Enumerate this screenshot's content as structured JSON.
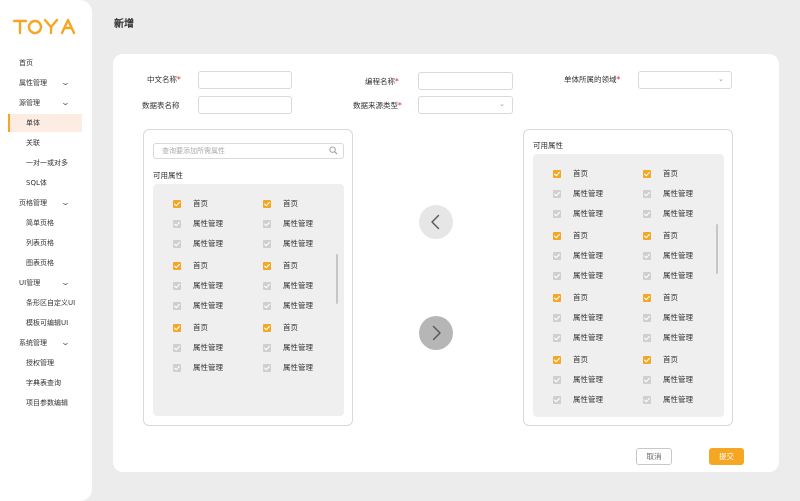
{
  "brand": {
    "logo_text": "TOYA",
    "logo_color": "#f5a623"
  },
  "sidebar": {
    "items": [
      {
        "label": "首页",
        "level": 0,
        "expandable": false,
        "active": false
      },
      {
        "label": "属性管理",
        "level": 0,
        "expandable": true,
        "active": false
      },
      {
        "label": "源管理",
        "level": 0,
        "expandable": true,
        "active": false
      },
      {
        "label": "单体",
        "level": 1,
        "expandable": false,
        "active": true
      },
      {
        "label": "关联",
        "level": 1,
        "expandable": false,
        "active": false
      },
      {
        "label": "一对一或对多",
        "level": 1,
        "expandable": false,
        "active": false
      },
      {
        "label": "SQL体",
        "level": 1,
        "expandable": false,
        "active": false
      },
      {
        "label": "页格管理",
        "level": 0,
        "expandable": true,
        "active": false
      },
      {
        "label": "简单页格",
        "level": 1,
        "expandable": false,
        "active": false
      },
      {
        "label": "列表页格",
        "level": 1,
        "expandable": false,
        "active": false
      },
      {
        "label": "图表页格",
        "level": 1,
        "expandable": false,
        "active": false
      },
      {
        "label": "UI管理",
        "level": 0,
        "expandable": true,
        "active": false
      },
      {
        "label": "条形区自定义UI",
        "level": 1,
        "expandable": false,
        "active": false
      },
      {
        "label": "模板可编辑UI",
        "level": 1,
        "expandable": false,
        "active": false
      },
      {
        "label": "系统管理",
        "level": 0,
        "expandable": true,
        "active": false
      },
      {
        "label": "授权管理",
        "level": 1,
        "expandable": false,
        "active": false
      },
      {
        "label": "字典表查询",
        "level": 1,
        "expandable": false,
        "active": false
      },
      {
        "label": "项目参数编辑",
        "level": 1,
        "expandable": false,
        "active": false
      }
    ]
  },
  "page": {
    "title": "新增"
  },
  "form": {
    "fields": [
      {
        "label": "中文名称",
        "required": true,
        "type": "text",
        "value": ""
      },
      {
        "label": "编程名称",
        "required": true,
        "type": "text",
        "value": ""
      },
      {
        "label": "单体所属的领域",
        "required": true,
        "type": "select",
        "value": ""
      },
      {
        "label": "数据表名称",
        "required": false,
        "type": "text",
        "value": ""
      },
      {
        "label": "数据来源类型",
        "required": true,
        "type": "select",
        "value": ""
      }
    ]
  },
  "left_panel": {
    "search_placeholder": "查询要添加所需属性",
    "title": "可用属性",
    "rows": [
      [
        {
          "label": "首页",
          "checked": true
        },
        {
          "label": "首页",
          "checked": true
        }
      ],
      [
        {
          "label": "属性管理",
          "checked": false
        },
        {
          "label": "属性管理",
          "checked": false
        }
      ],
      [
        {
          "label": "属性管理",
          "checked": false
        },
        {
          "label": "属性管理",
          "checked": false
        }
      ],
      [
        {
          "label": "首页",
          "checked": true
        },
        {
          "label": "首页",
          "checked": true
        }
      ],
      [
        {
          "label": "属性管理",
          "checked": false
        },
        {
          "label": "属性管理",
          "checked": false
        }
      ],
      [
        {
          "label": "属性管理",
          "checked": false
        },
        {
          "label": "属性管理",
          "checked": false
        }
      ],
      [
        {
          "label": "首页",
          "checked": true
        },
        {
          "label": "首页",
          "checked": true
        }
      ],
      [
        {
          "label": "属性管理",
          "checked": false
        },
        {
          "label": "属性管理",
          "checked": false
        }
      ],
      [
        {
          "label": "属性管理",
          "checked": false
        },
        {
          "label": "属性管理",
          "checked": false
        }
      ]
    ]
  },
  "right_panel": {
    "title": "可用属性",
    "rows": [
      [
        {
          "label": "首页",
          "checked": true
        },
        {
          "label": "首页",
          "checked": true
        }
      ],
      [
        {
          "label": "属性管理",
          "checked": false
        },
        {
          "label": "属性管理",
          "checked": false
        }
      ],
      [
        {
          "label": "属性管理",
          "checked": false
        },
        {
          "label": "属性管理",
          "checked": false
        }
      ],
      [
        {
          "label": "首页",
          "checked": true
        },
        {
          "label": "首页",
          "checked": true
        }
      ],
      [
        {
          "label": "属性管理",
          "checked": false
        },
        {
          "label": "属性管理",
          "checked": false
        }
      ],
      [
        {
          "label": "属性管理",
          "checked": false
        },
        {
          "label": "属性管理",
          "checked": false
        }
      ],
      [
        {
          "label": "首页",
          "checked": true
        },
        {
          "label": "首页",
          "checked": true
        }
      ],
      [
        {
          "label": "属性管理",
          "checked": false
        },
        {
          "label": "属性管理",
          "checked": false
        }
      ],
      [
        {
          "label": "属性管理",
          "checked": false
        },
        {
          "label": "属性管理",
          "checked": false
        }
      ],
      [
        {
          "label": "首页",
          "checked": true
        },
        {
          "label": "首页",
          "checked": true
        }
      ],
      [
        {
          "label": "属性管理",
          "checked": false
        },
        {
          "label": "属性管理",
          "checked": false
        }
      ],
      [
        {
          "label": "属性管理",
          "checked": false
        },
        {
          "label": "属性管理",
          "checked": false
        }
      ]
    ]
  },
  "transfer": {
    "left_icon": "chevron-left-icon",
    "right_icon": "chevron-right-icon"
  },
  "actions": {
    "cancel_label": "取消",
    "submit_label": "提交"
  },
  "colors": {
    "accent": "#f5a623",
    "required": "#e02020",
    "background": "#ececec"
  }
}
